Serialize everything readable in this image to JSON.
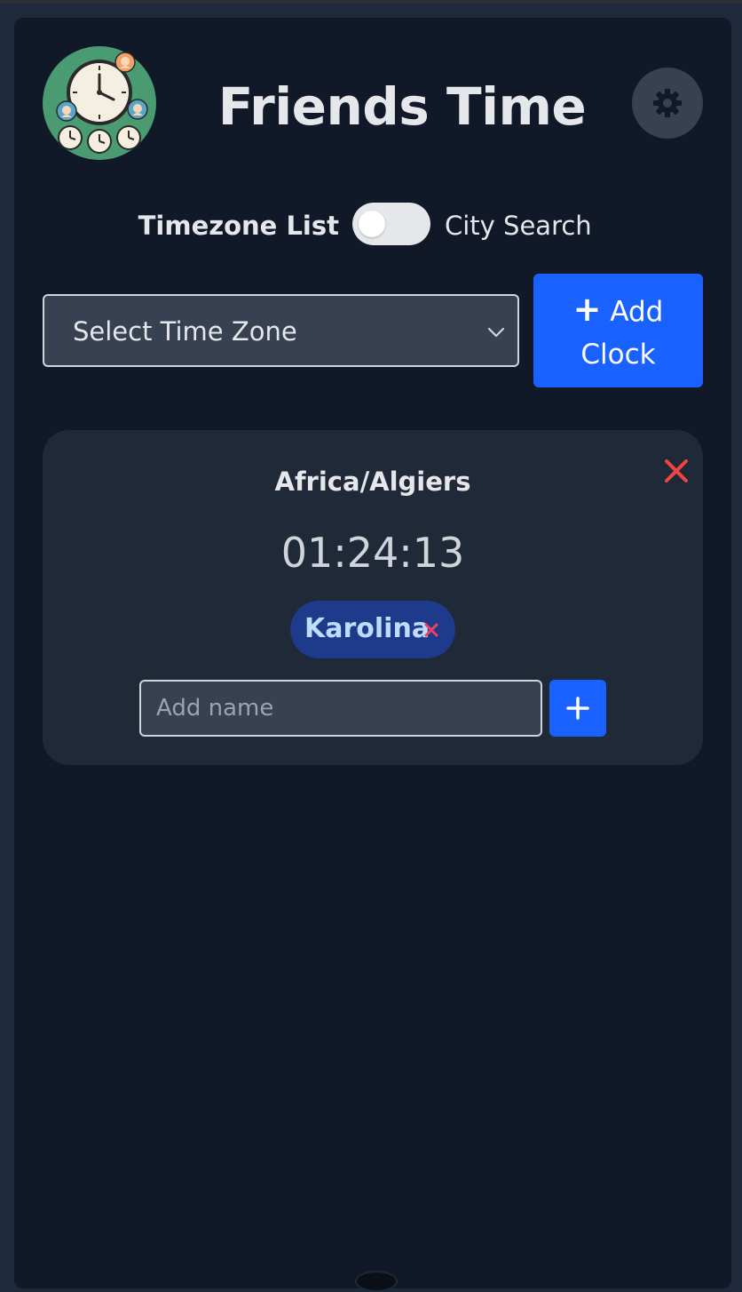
{
  "header": {
    "title": "Friends Time",
    "logo_icon": "clock-friends-logo-icon",
    "settings_icon": "gear-icon"
  },
  "mode_toggle": {
    "left_label": "Timezone List",
    "right_label": "City Search",
    "state": "off"
  },
  "zone_select": {
    "selected": "Select Time Zone",
    "icon": "chevron-down-icon"
  },
  "add_clock": {
    "plus": "+",
    "label_line1": "Add",
    "label_line2": "Clock"
  },
  "clocks": [
    {
      "zone": "Africa/Algiers",
      "time": "01:24:13",
      "friends": [
        {
          "name": "Karolina"
        }
      ],
      "name_input_placeholder": "Add name",
      "name_input_value": ""
    }
  ],
  "colors": {
    "page_bg": "#1e293b",
    "panel_bg": "#111827",
    "card_bg": "#1f2937",
    "accent_blue": "#1a62ff",
    "chip_bg": "#1e3a8a",
    "danger": "#ef4444",
    "logo_green": "#4a9a72"
  }
}
